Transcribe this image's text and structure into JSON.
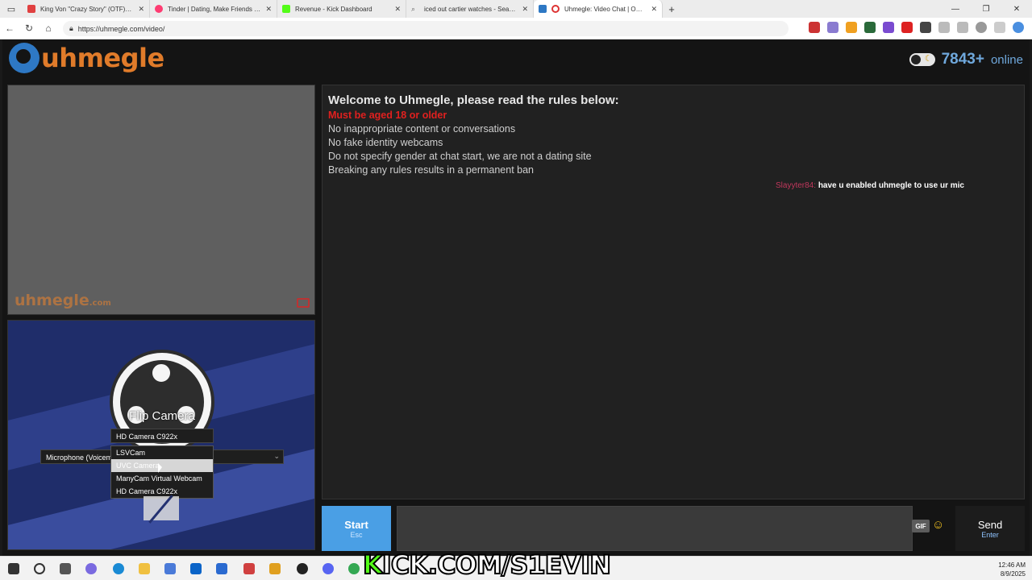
{
  "browser": {
    "tabs": [
      {
        "label": "King Von \"Crazy Story\" (OTF) (WS",
        "color": "#e04040"
      },
      {
        "label": "Tinder | Dating, Make Friends & M",
        "color": "#fe3c72"
      },
      {
        "label": "Revenue - Kick Dashboard",
        "color": "#53fc18"
      },
      {
        "label": "iced out cartier watches - Search",
        "color": "#999999"
      },
      {
        "label": "Uhmegle: Video Chat | Omegle",
        "color": "#2e78c4"
      }
    ],
    "url": "https://uhmegle.com/video/"
  },
  "header": {
    "logo_text": "uhmegle",
    "online_count": "7843+",
    "online_label": "online"
  },
  "stranger": {
    "watermark": "uhmegle",
    "watermark_suffix": ".com"
  },
  "self_video": {
    "flip_label": "Flip Camera",
    "camera_selected": "HD Camera C922x",
    "mic_selected": "Microphone (Voicemod Virtual Audio Device)",
    "camera_options": [
      "LSVCam",
      "UVC Camera",
      "ManyCam Virtual Webcam",
      "HD Camera C922x"
    ]
  },
  "chat": {
    "welcome": "Welcome to Uhmegle, please read the rules below:",
    "rules": [
      "Must be aged 18 or older",
      "No inappropriate content or conversations",
      "No fake identity webcams",
      "Do not specify gender at chat start, we are not a dating site",
      "Breaking any rules results in a permanent ban"
    ],
    "message_nick": "Slayyter84:",
    "message_text": "have u enabled uhmegle to use ur mic"
  },
  "controls": {
    "start_label": "Start",
    "start_hint": "Esc",
    "gif_label": "GIF",
    "send_label": "Send",
    "send_hint": "Enter"
  },
  "taskbar": {
    "time": "12:46 AM",
    "date": "8/9/2025"
  },
  "stream_overlay": {
    "prefix": "K",
    "text": "ICK.COM/S1EVIN"
  }
}
